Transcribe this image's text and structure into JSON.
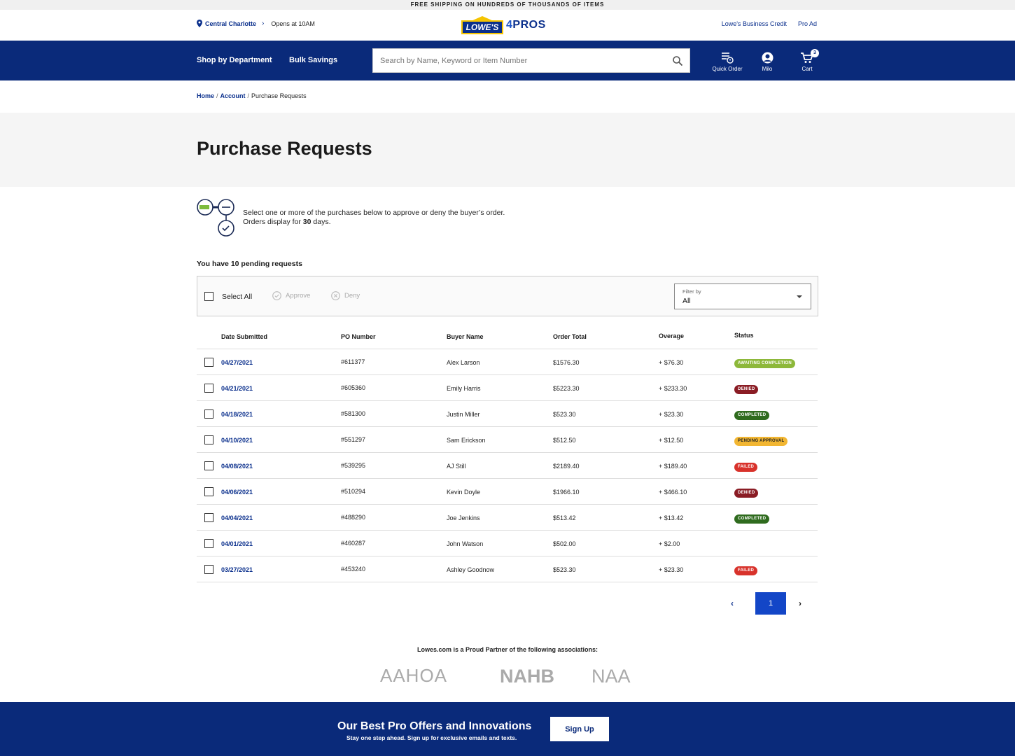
{
  "promo": {
    "text": "FREE SHIPPING ON HUNDREDS OF THOUSANDS OF ITEMS"
  },
  "util": {
    "store": "Central Charlotte",
    "hours": "Opens at 10AM",
    "logo_main": "LOWE'S",
    "logo_four": "4",
    "logo_pros": "PROS",
    "link_credit": "Lowe's Business Credit",
    "link_proad": "Pro Ad"
  },
  "nav": {
    "shop_by_department": "Shop by Department",
    "bulk_savings": "Bulk Savings",
    "search_placeholder": "Search by Name, Keyword or Item Number",
    "quick_order": "Quick Order",
    "user": "Milo",
    "cart": "Cart",
    "cart_count": "3"
  },
  "breadcrumb": {
    "home": "Home",
    "account": "Account",
    "current": "Purchase Requests"
  },
  "page": {
    "title": "Purchase Requests",
    "intro_line1": "Select one or more of the purchases below to approve or deny the buyer’s order.",
    "intro_line2_pre": "Orders display for ",
    "intro_days": "30",
    "intro_line2_post": " days.",
    "pending": "You have 10 pending requests"
  },
  "toolbar": {
    "select_all": "Select All",
    "approve": "Approve",
    "deny": "Deny",
    "filter_label": "Filter by",
    "filter_value": "All"
  },
  "table": {
    "headers": {
      "date": "Date Submitted",
      "po": "PO Number",
      "buyer": "Buyer Name",
      "total": "Order Total",
      "overage": "Overage",
      "status": "Status"
    },
    "rows": [
      {
        "date": "04/27/2021",
        "po": "#611377",
        "buyer": "Alex Larson",
        "total": "$1576.30",
        "overage": "+ $76.30",
        "status": "AWAITING COMPLETION",
        "status_color": "#8db83a"
      },
      {
        "date": "04/21/2021",
        "po": "#605360",
        "buyer": "Emily Harris",
        "total": "$5223.30",
        "overage": "+ $233.30",
        "status": "DENIED",
        "status_color": "#8a1c24"
      },
      {
        "date": "04/18/2021",
        "po": "#581300",
        "buyer": "Justin Miller",
        "total": "$523.30",
        "overage": "+ $23.30",
        "status": "COMPLETED",
        "status_color": "#2f6b1e"
      },
      {
        "date": "04/10/2021",
        "po": "#551297",
        "buyer": "Sam Erickson",
        "total": "$512.50",
        "overage": "+ $12.50",
        "status": "PENDING APPROVAL",
        "status_color": "#f2b632"
      },
      {
        "date": "04/08/2021",
        "po": "#539295",
        "buyer": "AJ Still",
        "total": "$2189.40",
        "overage": "+ $189.40",
        "status": "FAILED",
        "status_color": "#d8322b"
      },
      {
        "date": "04/06/2021",
        "po": "#510294",
        "buyer": "Kevin Doyle",
        "total": "$1966.10",
        "overage": "+ $466.10",
        "status": "DENIED",
        "status_color": "#8a1c24"
      },
      {
        "date": "04/04/2021",
        "po": "#488290",
        "buyer": "Joe Jenkins",
        "total": "$513.42",
        "overage": "+ $13.42",
        "status": "COMPLETED",
        "status_color": "#2f6b1e"
      },
      {
        "date": "04/01/2021",
        "po": "#460287",
        "buyer": "John Watson",
        "total": "$502.00",
        "overage": "+ $2.00",
        "status": "",
        "status_color": ""
      },
      {
        "date": "03/27/2021",
        "po": "#453240",
        "buyer": "Ashley Goodnow",
        "total": "$523.30",
        "overage": "+ $23.30",
        "status": "FAILED",
        "status_color": "#d8322b"
      }
    ]
  },
  "pager": {
    "current": "1"
  },
  "partners": {
    "title": "Lowes.com is a Proud Partner of the following associations:",
    "aahoa": "AAHOA",
    "nahb": "NAHB",
    "naa": "NAA"
  },
  "footer": {
    "title": "Our Best Pro Offers and Innovations",
    "subtitle": "Stay one step ahead. Sign up for exclusive emails and texts.",
    "signup": "Sign Up"
  }
}
